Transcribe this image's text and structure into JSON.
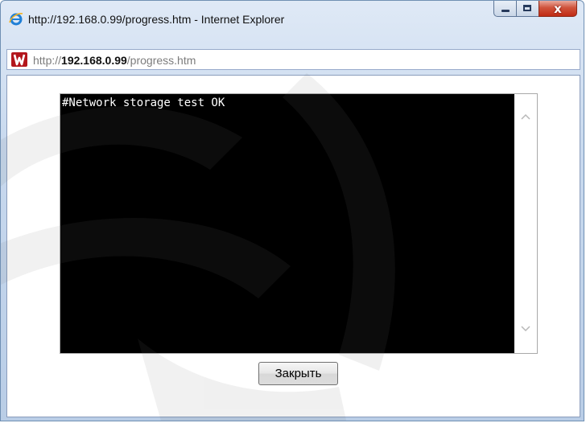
{
  "window": {
    "title": "http://192.168.0.99/progress.htm - Internet Explorer",
    "icon": "internet-explorer-icon",
    "controls": [
      "minimize",
      "maximize",
      "close"
    ],
    "close_glyph": "x"
  },
  "address_bar": {
    "prefix": "http://",
    "host": "192.168.0.99",
    "path": "/progress.htm",
    "site_icon": "site-favicon"
  },
  "console": {
    "text": "#Network storage test OK"
  },
  "buttons": {
    "close_label": "Закрыть"
  },
  "colors": {
    "console_bg": "#000000",
    "console_text": "#ffffff",
    "close_button_red": "#c02b14",
    "site_icon_red": "#b3161c"
  }
}
